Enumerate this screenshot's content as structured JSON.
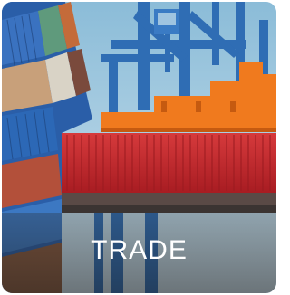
{
  "tile": {
    "caption": "TRADE",
    "image": "shipping-containers-crane-photo"
  },
  "colors": {
    "sky": "#9ec6dc",
    "crane_blue": "#2f6db4",
    "crane_orange": "#f07a1e",
    "container_red": "#c8262c",
    "container_stack_blue": "#2a5ea8",
    "caption_text": "#ffffff"
  }
}
